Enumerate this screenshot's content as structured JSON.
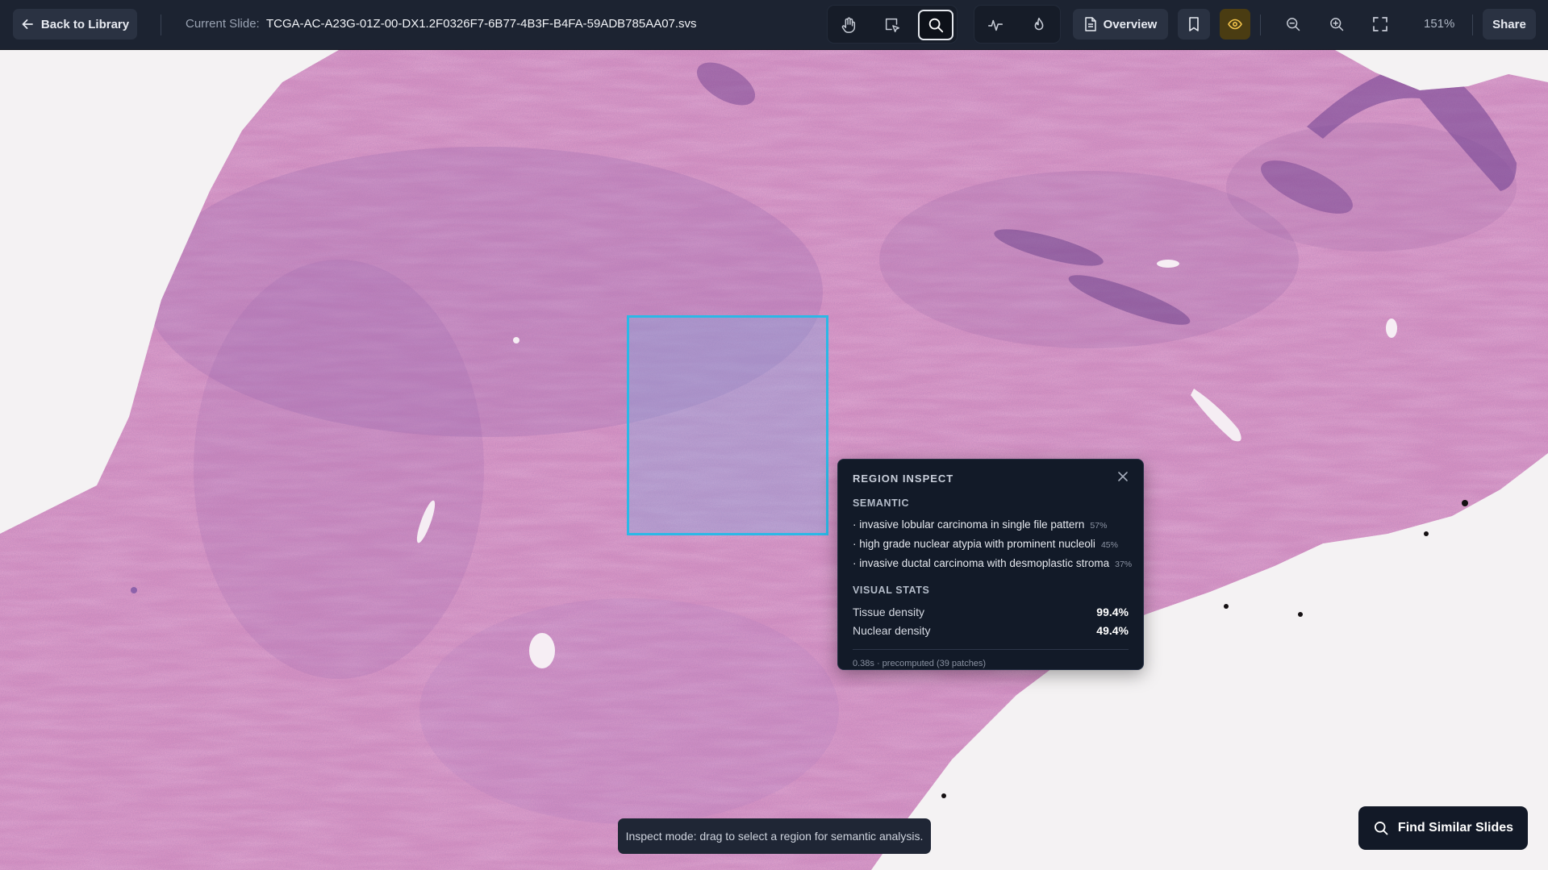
{
  "topbar": {
    "back_label": "Back to Library",
    "current_slide_label": "Current Slide:",
    "current_slide_name": "TCGA-AC-A23G-01Z-00-DX1.2F0326F7-6B77-4B3F-B4FA-59ADB785AA07.svs",
    "overview_label": "Overview",
    "zoom_level": "151%",
    "share_label": "Share",
    "tools": [
      {
        "name": "pan",
        "icon": "hand-icon",
        "active": false
      },
      {
        "name": "select",
        "icon": "cursor-select-icon",
        "active": false
      },
      {
        "name": "inspect",
        "icon": "search-icon",
        "active": true
      },
      {
        "name": "annotate",
        "icon": "activity-icon",
        "active": false
      },
      {
        "name": "heatmap",
        "icon": "flame-icon",
        "active": false
      }
    ]
  },
  "inspect_panel": {
    "title": "REGION INSPECT",
    "semantic_title": "SEMANTIC",
    "semantic_items": [
      {
        "label": "· invasive lobular carcinoma in single file pattern",
        "pct": "57%"
      },
      {
        "label": "· high grade nuclear atypia with prominent nucleoli",
        "pct": "45%"
      },
      {
        "label": "· invasive ductal carcinoma with desmoplastic stroma",
        "pct": "37%"
      }
    ],
    "visual_stats_title": "VISUAL STATS",
    "stats": [
      {
        "label": "Tissue density",
        "value": "99.4%"
      },
      {
        "label": "Nuclear density",
        "value": "49.4%"
      }
    ],
    "footnote": "0.38s · precomputed (39 patches)"
  },
  "toast": "Inspect mode: drag to select a region for semantic analysis.",
  "find_similar_label": "Find Similar Slides",
  "colors": {
    "topbar_bg": "#1c2331",
    "selection_border": "#2bb8e6",
    "eye_active": "#f3c34a",
    "tissue_pink": "#d791c2",
    "nuclei": "#5a3a86"
  }
}
